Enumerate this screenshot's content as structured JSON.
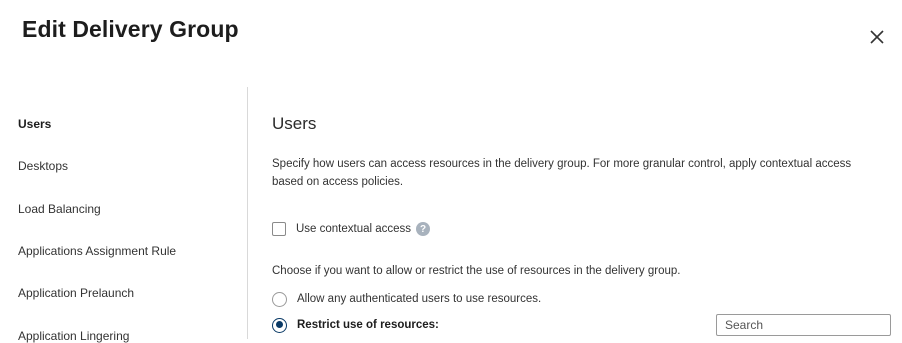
{
  "dialog": {
    "title": "Edit Delivery Group",
    "close_icon": "close-icon"
  },
  "sidebar": {
    "items": [
      {
        "label": "Users",
        "active": true
      },
      {
        "label": "Desktops",
        "active": false
      },
      {
        "label": "Load Balancing",
        "active": false
      },
      {
        "label": "Applications Assignment Rule",
        "active": false
      },
      {
        "label": "Application Prelaunch",
        "active": false
      },
      {
        "label": "Application Lingering",
        "active": false
      }
    ]
  },
  "main": {
    "section_title": "Users",
    "description": "Specify how users can access resources in the delivery group. For more granular control, apply contextual access based on access policies.",
    "contextual_access": {
      "label": "Use contextual access",
      "checked": false,
      "help_icon": "help-icon"
    },
    "choose_text": "Choose if you want to allow or restrict the use of resources in the delivery group.",
    "radio_options": [
      {
        "label": "Allow any authenticated users to use resources.",
        "checked": false
      },
      {
        "label": "Restrict use of resources:",
        "checked": true
      }
    ],
    "search": {
      "placeholder": "Search",
      "value": ""
    }
  },
  "colors": {
    "accent": "#0a3a66",
    "divider": "#d9d9d9",
    "help_icon_bg": "#a8b2bd"
  }
}
